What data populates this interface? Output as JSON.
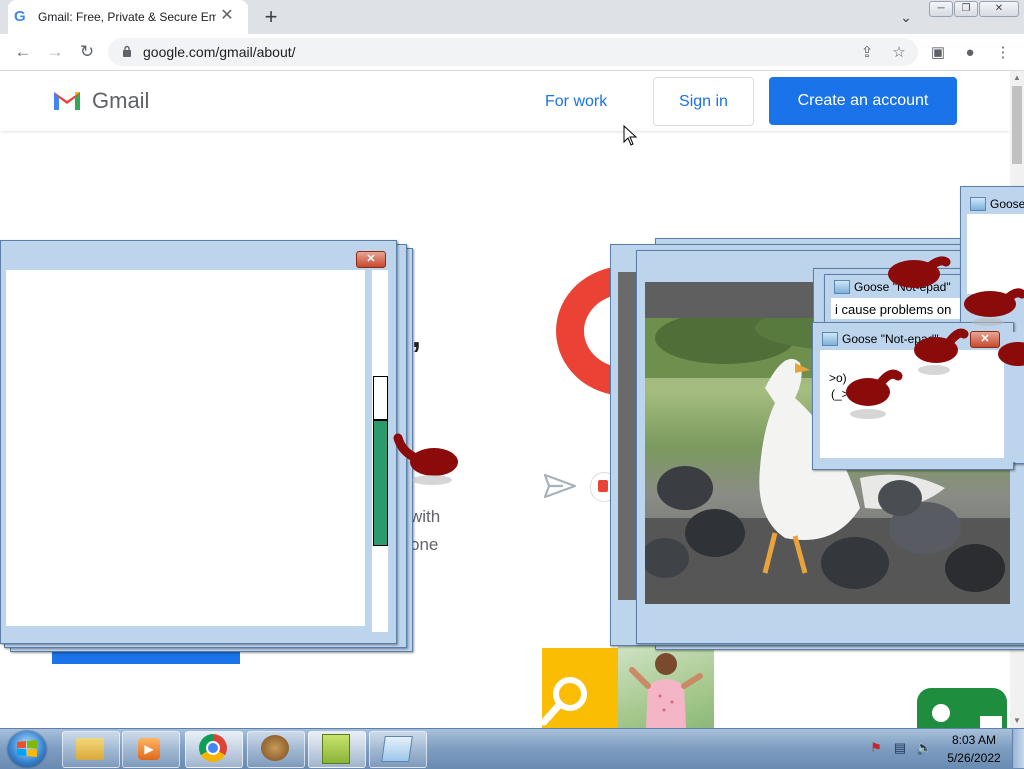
{
  "browser": {
    "tab_title": "Gmail: Free, Private & Secure Em",
    "tab_favicon": "G",
    "new_tab": "+",
    "url": "google.com/gmail/about/"
  },
  "gmail": {
    "logo_text": "Gmail",
    "for_work": "For work",
    "sign_in": "Sign in",
    "create_account": "Create an account",
    "comma": ",",
    "with": "with",
    "one": "one"
  },
  "windows": {
    "goose_title_1": "Goose \"Not-epad\"",
    "goose_title_2": "Goose \"Not-epad\"",
    "goose_title_3": "Goose",
    "goose_note_1": "i cause problems on",
    "goose_note_2_line1": ">o)",
    "goose_note_2_line2": "(_>"
  },
  "taskbar": {
    "time": "8:03 AM",
    "date": "5/26/2022",
    "items": [
      "explorer-icon",
      "media-player-icon",
      "chrome-icon",
      "goose-app-icon",
      "notepad-plus-icon",
      "notepad-icon"
    ]
  },
  "colors": {
    "gmail_blue": "#1a73e8",
    "gmail_red": "#ea4335",
    "goose_red": "#8b0a0a",
    "win7_frame": "#bcd4ec"
  }
}
